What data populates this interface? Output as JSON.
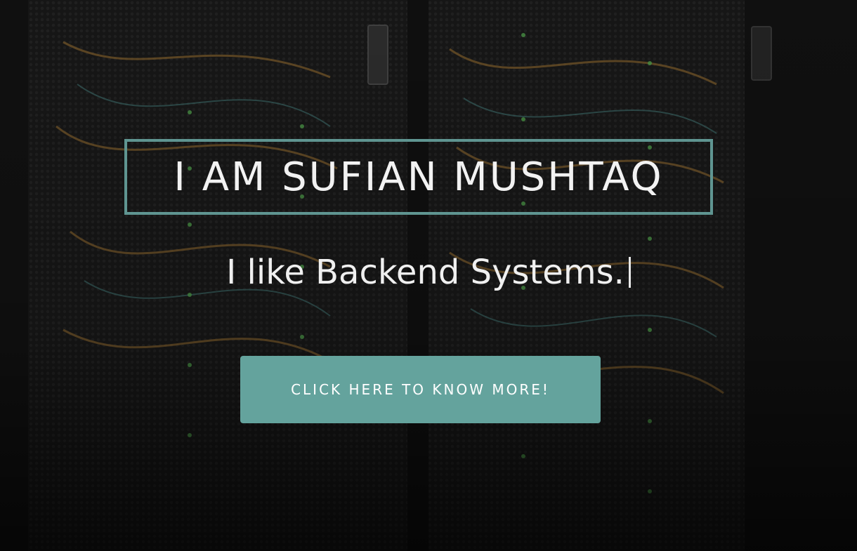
{
  "hero": {
    "title": "I AM SUFIAN MUSHTAQ",
    "subtitle": "I like Backend Systems.",
    "cta_label": "CLICK HERE TO KNOW MORE!"
  },
  "colors": {
    "accent": "#64a39d",
    "title_border": "#5f9591",
    "text": "#f2f2f2",
    "background": "#1c1c1c"
  },
  "background_image": "server-rack-photo"
}
